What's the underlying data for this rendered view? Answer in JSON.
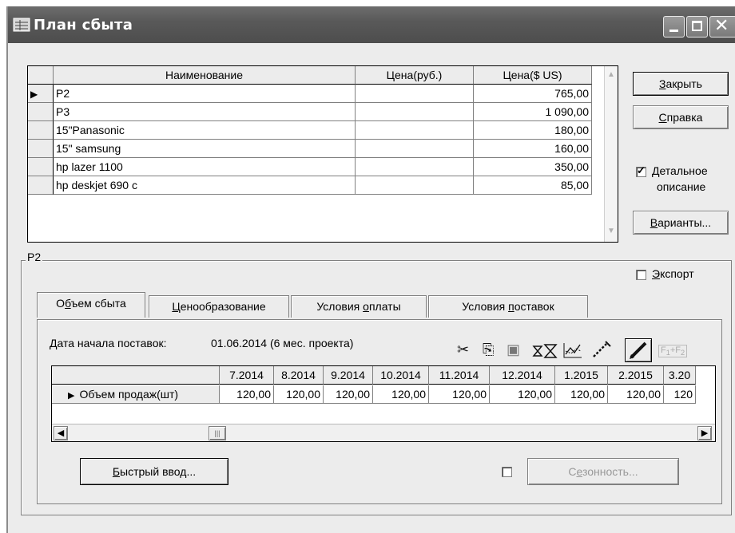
{
  "window": {
    "title": "План сбыта"
  },
  "products": {
    "headers": [
      "Наименование",
      "Цена(руб.)",
      "Цена($ US)"
    ],
    "rows": [
      {
        "name": "P2",
        "rub": "",
        "usd": "765,00",
        "selected": true
      },
      {
        "name": "P3",
        "rub": "",
        "usd": "1 090,00",
        "selected": false
      },
      {
        "name": "15\"Panasonic",
        "rub": "",
        "usd": "180,00",
        "selected": false
      },
      {
        "name": "15\" samsung",
        "rub": "",
        "usd": "160,00",
        "selected": false
      },
      {
        "name": "hp lazer 1100",
        "rub": "",
        "usd": "350,00",
        "selected": false
      },
      {
        "name": "hp deskjet 690 c",
        "rub": "",
        "usd": "85,00",
        "selected": false
      }
    ]
  },
  "buttons": {
    "close": {
      "hot": "З",
      "rest": "акрыть"
    },
    "help": {
      "hot": "С",
      "rest": "правка"
    },
    "variants": {
      "hot": "В",
      "rest": "арианты..."
    },
    "quick_input": {
      "hot": "Б",
      "rest": "ыстрый ввод..."
    },
    "seasonality": {
      "pre": "С",
      "hot": "е",
      "rest": "зонность..."
    }
  },
  "checkboxes": {
    "detailed": {
      "hot": "Д",
      "rest": "етальное",
      "line2": "описание",
      "checked": true
    },
    "export": {
      "hot": "Э",
      "rest": "кспорт",
      "checked": false
    },
    "seasonality_checked": false
  },
  "group": {
    "title": "P2"
  },
  "tabs": [
    {
      "pre": "О",
      "hot": "б",
      "rest": "ъем сбыта",
      "active": true
    },
    {
      "pre": "",
      "hot": "Ц",
      "rest": "енообразование",
      "active": false
    },
    {
      "pre": "Условия ",
      "hot": "о",
      "rest": "платы",
      "active": false
    },
    {
      "pre": "Условия ",
      "hot": "п",
      "rest": "оставок",
      "active": false
    }
  ],
  "start_date": {
    "label": "Дата начала поставок:",
    "value": "01.06.2014 (6 мес. проекта)"
  },
  "toolbar_icons": [
    "cut-icon",
    "copy-icon",
    "paste-icon",
    "hourglass-icon",
    "chart-icon",
    "wand-icon",
    "pencil-icon",
    "formula-icon"
  ],
  "sales": {
    "months": [
      "7.2014",
      "8.2014",
      "9.2014",
      "10.2014",
      "11.2014",
      "12.2014",
      "1.2015",
      "2.2015",
      "3.20"
    ],
    "row_label": "Объем продаж(шт)",
    "values": [
      "120,00",
      "120,00",
      "120,00",
      "120,00",
      "120,00",
      "120,00",
      "120,00",
      "120,00",
      "120"
    ]
  }
}
